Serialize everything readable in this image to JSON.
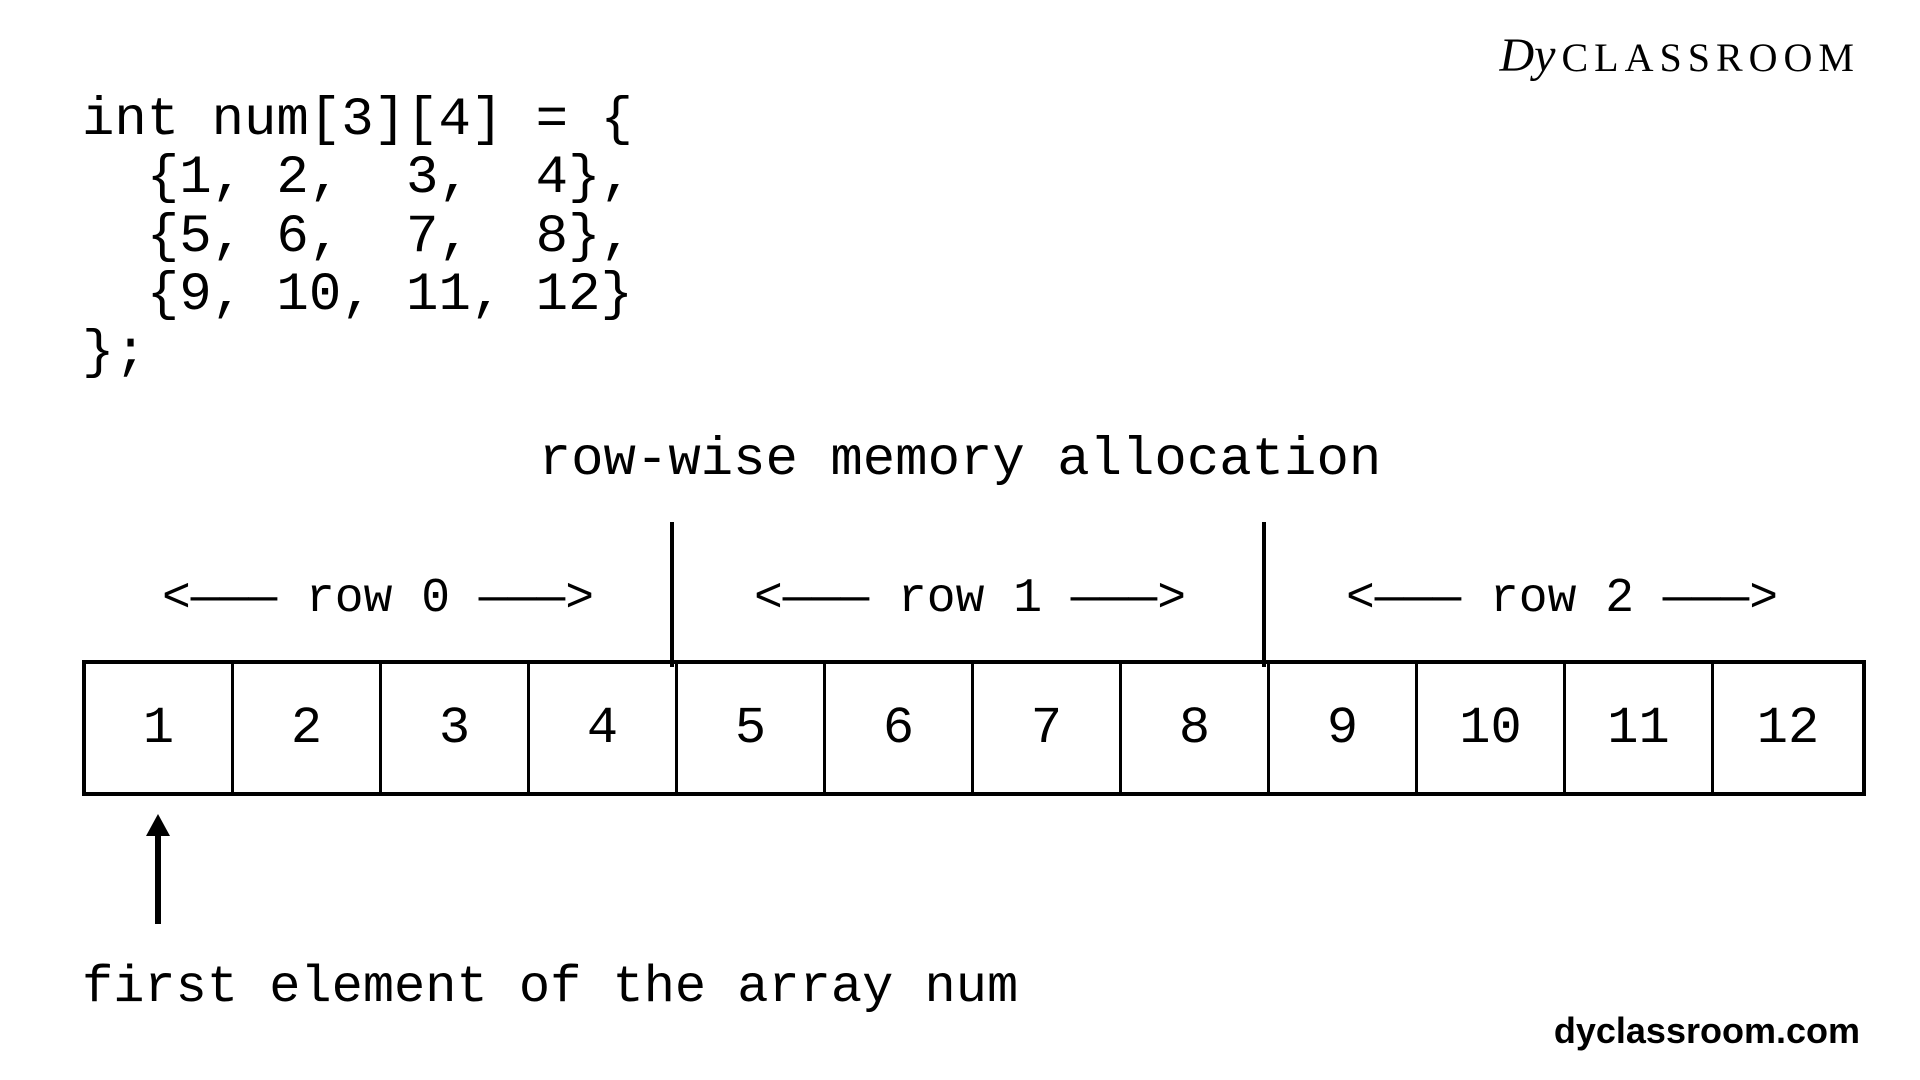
{
  "logo": {
    "prefix": "Dy",
    "text": "CLASSROOM"
  },
  "code": {
    "line1": "int num[3][4] = {",
    "line2": "  {1, 2,  3,  4},",
    "line3": "  {5, 6,  7,  8},",
    "line4": "  {9, 10, 11, 12}",
    "line5": "};"
  },
  "title": "row-wise memory allocation",
  "row_labels": [
    "<——— row 0 ———>",
    "<——— row 1 ———>",
    "<——— row 2 ———>"
  ],
  "cells": [
    "1",
    "2",
    "3",
    "4",
    "5",
    "6",
    "7",
    "8",
    "9",
    "10",
    "11",
    "12"
  ],
  "arrow_label": "first element of the array num",
  "site": "dyclassroom.com",
  "chart_data": {
    "type": "table",
    "title": "row-wise memory allocation",
    "rows": 3,
    "cols": 4,
    "matrix": [
      [
        1,
        2,
        3,
        4
      ],
      [
        5,
        6,
        7,
        8
      ],
      [
        9,
        10,
        11,
        12
      ]
    ],
    "flat": [
      1,
      2,
      3,
      4,
      5,
      6,
      7,
      8,
      9,
      10,
      11,
      12
    ],
    "row_groups": [
      {
        "label": "row 0",
        "start_index": 0,
        "end_index": 3
      },
      {
        "label": "row 1",
        "start_index": 4,
        "end_index": 7
      },
      {
        "label": "row 2",
        "start_index": 8,
        "end_index": 11
      }
    ],
    "pointer": {
      "index": 0,
      "label": "first element of the array num"
    }
  }
}
